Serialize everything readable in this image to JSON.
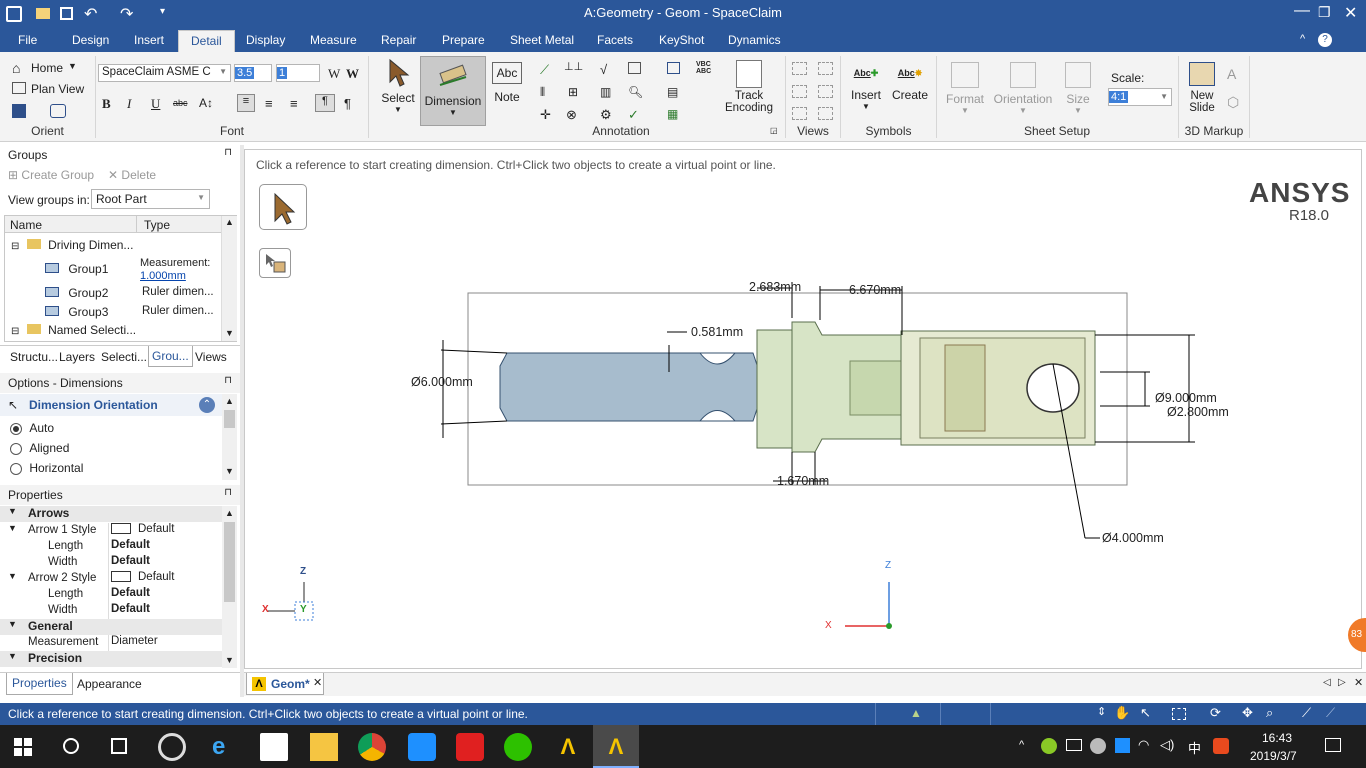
{
  "window": {
    "title": "A:Geometry - Geom - SpaceClaim"
  },
  "menu": {
    "tabs": [
      "File",
      "Design",
      "Insert",
      "Detail",
      "Display",
      "Measure",
      "Repair",
      "Prepare",
      "Sheet Metal",
      "Facets",
      "KeyShot",
      "Dynamics"
    ],
    "active": "Detail"
  },
  "ribbon": {
    "orient": {
      "home": "Home",
      "plan_view": "Plan View",
      "group": "Orient"
    },
    "font": {
      "family": "SpaceClaim ASME C",
      "size": "3.5",
      "width": "1",
      "group": "Font"
    },
    "select": "Select",
    "dimension": "Dimension",
    "note": "Note",
    "annotation_group": "Annotation",
    "track_encoding": "Track Encoding",
    "views_group": "Views",
    "insert": "Insert",
    "create": "Create",
    "symbols_group": "Symbols",
    "format": "Format",
    "orientation": "Orientation",
    "size": "Size",
    "sheet_setup_group": "Sheet Setup",
    "scale_label": "Scale:",
    "scale_value": "4:1",
    "new_slide": "New Slide",
    "markup_group": "3D Markup"
  },
  "groups_panel": {
    "title": "Groups",
    "create_group": "Create Group",
    "delete": "Delete",
    "view_in_label": "View groups in:",
    "view_in_value": "Root Part",
    "col_name": "Name",
    "col_type": "Type",
    "rows": [
      {
        "name": "Driving Dimen...",
        "type": ""
      },
      {
        "name": "Group1",
        "type": "Measurement:",
        "link": "1.000mm"
      },
      {
        "name": "Group2",
        "type": "Ruler dimen..."
      },
      {
        "name": "Group3",
        "type": "Ruler dimen..."
      },
      {
        "name": "Named Selecti...",
        "type": ""
      }
    ],
    "tabs": [
      "Structu...",
      "Layers",
      "Selecti...",
      "Grou...",
      "Views"
    ]
  },
  "options_panel": {
    "title": "Options - Dimensions",
    "section": "Dimension Orientation",
    "radios": [
      "Auto",
      "Aligned",
      "Horizontal"
    ],
    "selected": "Auto"
  },
  "properties_panel": {
    "title": "Properties",
    "cat_arrows": "Arrows",
    "arrow1": "Arrow 1 Style",
    "arrow1_val": "Default",
    "length1": "Length",
    "length1_val": "Default",
    "width1": "Width",
    "width1_val": "Default",
    "arrow2": "Arrow 2 Style",
    "arrow2_val": "Default",
    "length2": "Length",
    "length2_val": "Default",
    "width2": "Width",
    "width2_val": "Default",
    "cat_general": "General",
    "measurement": "Measurement",
    "measurement_val": "Diameter",
    "cat_precision": "Precision",
    "tabs": [
      "Properties",
      "Appearance"
    ]
  },
  "canvas": {
    "hint": "Click a reference to start creating dimension. Ctrl+Click two objects to create a virtual point or line.",
    "brand": "ANSYS",
    "version": "R18.0",
    "dims": {
      "d1": "2.683mm",
      "d2": "6.670mm",
      "d3": "0.581mm",
      "d4": "Ø6.000mm",
      "d5": "Ø9.000mm",
      "d6": "Ø2.800mm",
      "d7": "1.670mm",
      "d8": "Ø4.000mm"
    },
    "axes": {
      "z": "Z",
      "x": "X",
      "y": "Y"
    }
  },
  "doc_tab": "Geom*",
  "status": "Click a reference to start creating dimension. Ctrl+Click two objects to create a virtual point or line.",
  "taskbar": {
    "time": "16:43",
    "date": "2019/3/7",
    "ime": "中"
  },
  "colors": {
    "accent": "#2b579a",
    "shaft": "#a7bccd",
    "body": "#d7e4c6"
  }
}
